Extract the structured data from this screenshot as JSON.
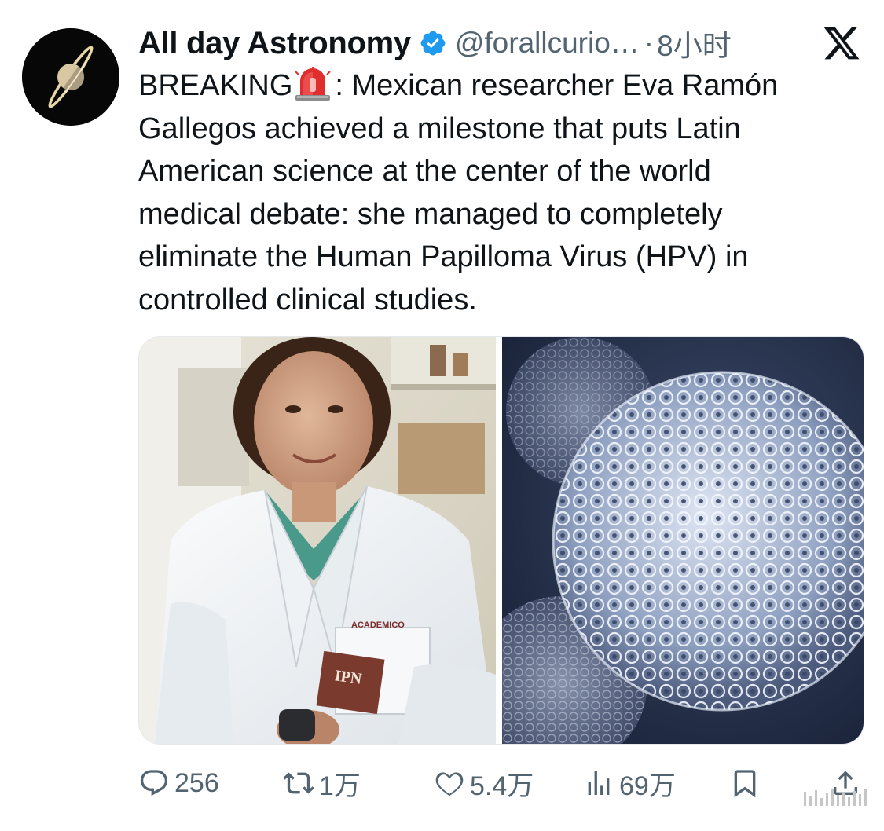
{
  "tweet": {
    "display_name": "All day Astronomy",
    "handle": "@forallcurio…",
    "separator": "·",
    "time": "8小时",
    "text_line_1_pre": "BREAKING",
    "text_line_1_post": ": Mexican researcher Eva Ramón",
    "text_rest": [
      "Gallegos achieved a milestone that puts Latin",
      "American science at the center of the world",
      "medical debate: she managed to completely",
      "eliminate the Human Papilloma Virus (HPV) in",
      "controlled clinical studies."
    ],
    "lab_coat_text": "ACADEMICO",
    "badge_text": "IPN"
  },
  "actions": {
    "reply_count": "256",
    "retweet_count": "1万",
    "like_count": "5.4万",
    "views_count": "69万"
  },
  "icons": {
    "verified": "verified-badge-icon",
    "platform": "x-logo-icon",
    "siren": "police-siren-emoji",
    "reply": "reply-icon",
    "retweet": "retweet-icon",
    "like": "heart-icon",
    "views": "views-icon",
    "bookmark": "bookmark-icon",
    "share": "share-icon"
  },
  "colors": {
    "text": "#0f1419",
    "secondary": "#536471",
    "verified": "#1d9bf0"
  }
}
